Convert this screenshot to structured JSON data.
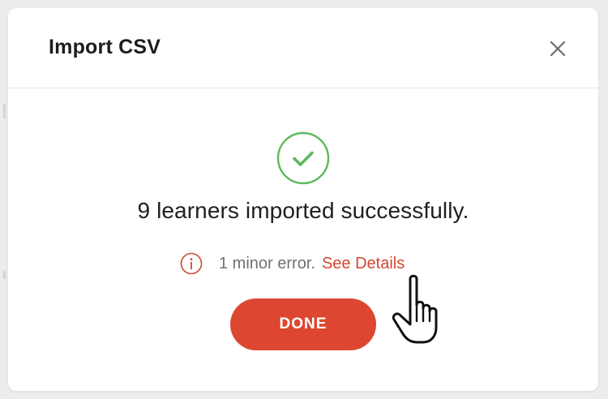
{
  "dialog": {
    "title": "Import CSV",
    "close_icon": "close-icon"
  },
  "result": {
    "status_icon": "check-circle-icon",
    "message": "9 learners imported successfully.",
    "error_icon": "info-circle-icon",
    "error_text": "1 minor error.",
    "details_link": "See Details"
  },
  "actions": {
    "done_label": "DONE"
  },
  "cursor": "hand-pointer-icon",
  "colors": {
    "accent": "#dd4731",
    "link": "#d44532",
    "success": "#5cb85c",
    "text": "#1f1f22",
    "muted": "#707074"
  }
}
